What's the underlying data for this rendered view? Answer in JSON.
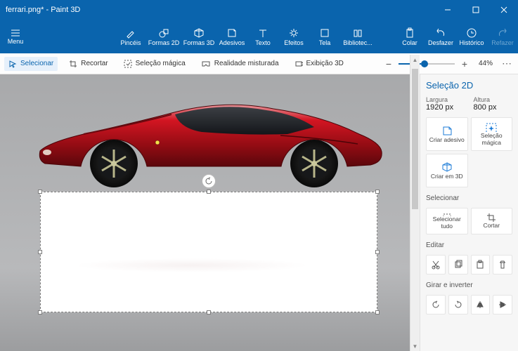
{
  "titlebar": {
    "title": "ferrari.png* - Paint 3D"
  },
  "ribbon": {
    "menu": "Menu",
    "brushes": "Pincéis",
    "shapes2d": "Formas 2D",
    "shapes3d": "Formas 3D",
    "stickers": "Adesivos",
    "text": "Texto",
    "effects": "Efeitos",
    "canvas": "Tela",
    "library": "Bibliotec...",
    "paste": "Colar",
    "undo": "Desfazer",
    "history": "Histórico",
    "redo": "Refazer"
  },
  "toolbar": {
    "select": "Selecionar",
    "crop": "Recortar",
    "magic": "Seleção mágica",
    "mixed": "Realidade misturada",
    "view3d": "Exibição 3D",
    "zoom": "44%"
  },
  "panel": {
    "title": "Seleção 2D",
    "width_label": "Largura",
    "width_value": "1920 px",
    "height_label": "Altura",
    "height_value": "800 px",
    "make_sticker": "Criar adesivo",
    "magic_select": "Seleção mágica",
    "make_3d": "Criar em 3D",
    "select_header": "Selecionar",
    "select_all": "Selecionar tudo",
    "crop": "Cortar",
    "edit_header": "Editar",
    "rotate_header": "Girar e inverter"
  }
}
